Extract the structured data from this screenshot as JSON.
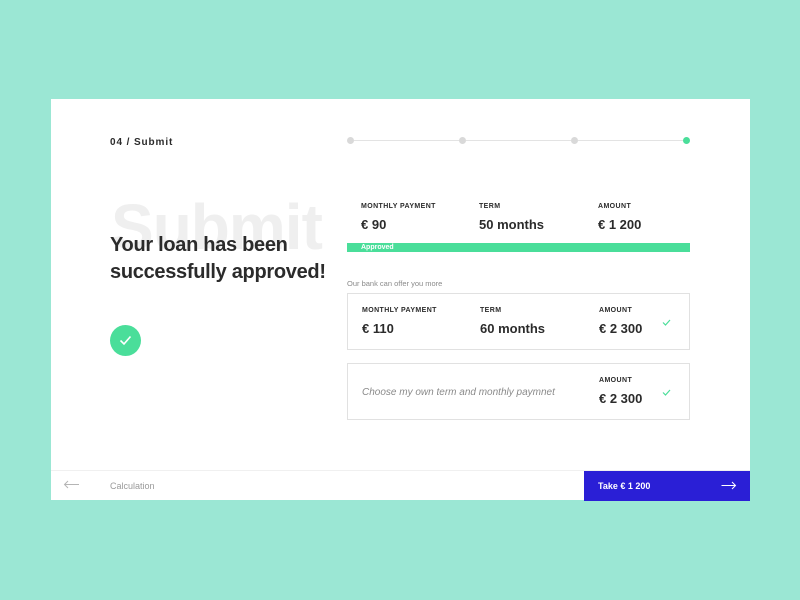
{
  "step": {
    "label": "04 / Submit",
    "total": 4,
    "current": 4
  },
  "hero": {
    "background_word": "Submit",
    "headline": "Your loan has been successfully approved!",
    "status_icon": "check-icon"
  },
  "approved_offer": {
    "monthly_payment_label": "MONTHLY PAYMENT",
    "monthly_payment_value": "€ 90",
    "term_label": "TERM",
    "term_value": "50 months",
    "amount_label": "AMOUNT",
    "amount_value": "€ 1 200",
    "status_label": "Approved"
  },
  "more_offers_label": "Our bank can offer you more",
  "alt_offer": {
    "monthly_payment_label": "MONTHLY PAYMENT",
    "monthly_payment_value": "€ 110",
    "term_label": "TERM",
    "term_value": "60 months",
    "amount_label": "AMOUNT",
    "amount_value": "€ 2 300"
  },
  "custom_offer": {
    "text": "Choose my own term and monthly paymnet",
    "amount_label": "AMOUNT",
    "amount_value": "€ 2 300"
  },
  "footer": {
    "back_label": "Calculation",
    "take_label": "Take € 1 200"
  },
  "colors": {
    "background": "#9be7d4",
    "accent_green": "#4ade9a",
    "primary_button": "#2a1fd6"
  }
}
